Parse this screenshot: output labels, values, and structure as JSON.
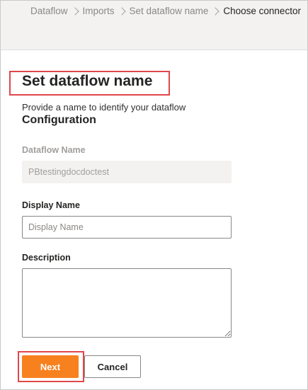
{
  "breadcrumb": {
    "items": [
      "Dataflow",
      "Imports",
      "Set dataflow name",
      "Choose connector"
    ]
  },
  "page": {
    "title": "Set dataflow name",
    "subtitle": "Provide a name to identify your dataflow",
    "section_heading": "Configuration"
  },
  "fields": {
    "dataflow_name": {
      "label": "Dataflow Name",
      "value": "PBtestingdocdoctest"
    },
    "display_name": {
      "label": "Display Name",
      "placeholder": "Display Name",
      "value": ""
    },
    "description": {
      "label": "Description",
      "value": ""
    }
  },
  "actions": {
    "next_label": "Next",
    "cancel_label": "Cancel"
  },
  "colors": {
    "accent": "#f7801f",
    "highlight": "#e0474c",
    "header_bg": "#f3f2f1"
  }
}
